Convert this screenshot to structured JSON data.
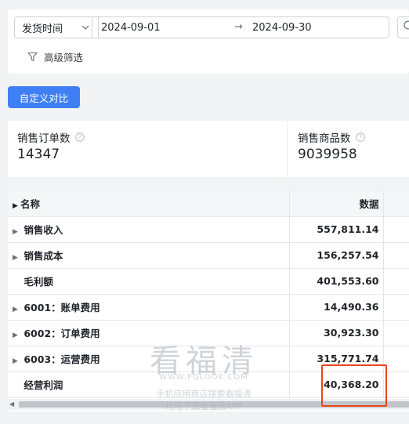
{
  "filters": {
    "date_type": "发货时间",
    "date_start": "2024-09-01",
    "date_separator": "→",
    "date_end": "2024-09-30",
    "advanced_filter": "高级筛选"
  },
  "toolbar": {
    "custom_compare": "自定义对比"
  },
  "metrics": [
    {
      "label": "销售订单数",
      "value": "14347"
    },
    {
      "label": "销售商品数",
      "value": "9039958"
    }
  ],
  "table": {
    "headers": [
      "名称",
      "数据"
    ],
    "rows": [
      {
        "name": "销售收入",
        "value": "557,811.14"
      },
      {
        "name": "销售成本",
        "value": "156,257.54"
      },
      {
        "name": "毛利额",
        "value": "401,553.60"
      },
      {
        "name": "6001：账单费用",
        "value": "14,490.36"
      },
      {
        "name": "6002：订单费用",
        "value": "30,923.30"
      },
      {
        "name": "6003：运营费用",
        "value": "315,771.74"
      },
      {
        "name": "经营利润",
        "value": "40,368.20"
      }
    ]
  },
  "watermark": {
    "brand": "看福清",
    "url": "WWW.FQLOOK.COM",
    "line1": "手机应用商店搜索看福清",
    "line2": "均可下载看福清APP"
  },
  "colors": {
    "primary": "#3f7ff3",
    "highlight": "#e8461c"
  }
}
